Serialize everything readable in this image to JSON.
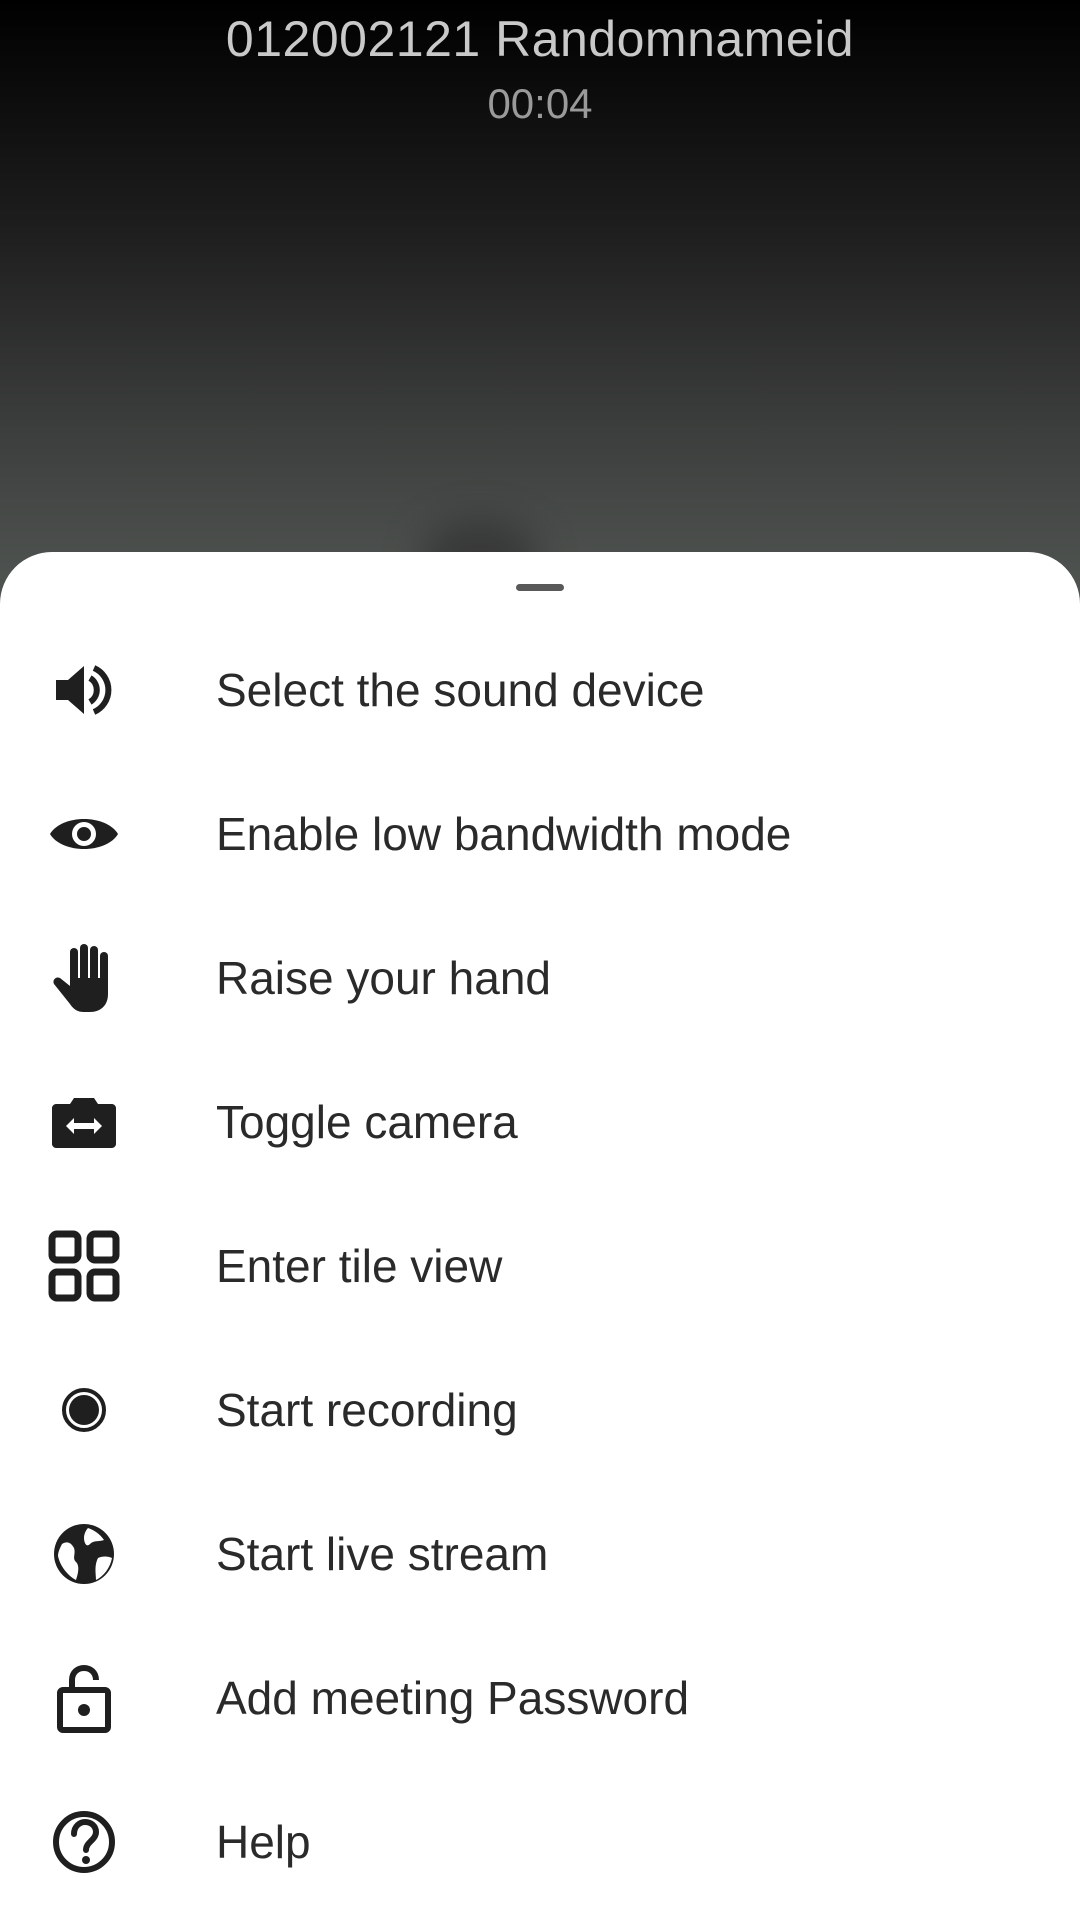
{
  "call": {
    "title": "012002121 Randomnameid",
    "timer": "00:04"
  },
  "menu": {
    "items": [
      {
        "label": "Select the sound device",
        "icon": "speaker-icon"
      },
      {
        "label": "Enable low bandwidth mode",
        "icon": "eye-icon"
      },
      {
        "label": "Raise your hand",
        "icon": "hand-icon"
      },
      {
        "label": "Toggle camera",
        "icon": "camera-switch-icon"
      },
      {
        "label": "Enter tile view",
        "icon": "tile-grid-icon"
      },
      {
        "label": "Start recording",
        "icon": "record-icon"
      },
      {
        "label": "Start live stream",
        "icon": "globe-icon"
      },
      {
        "label": "Add meeting Password",
        "icon": "lock-icon"
      },
      {
        "label": "Help",
        "icon": "help-icon"
      }
    ]
  },
  "colors": {
    "sheet_background": "#ffffff",
    "text_primary": "#2a2a2a",
    "icon": "#1f1f1f",
    "title_text": "#c9c9c9",
    "timer_text": "#9a9a9a"
  }
}
